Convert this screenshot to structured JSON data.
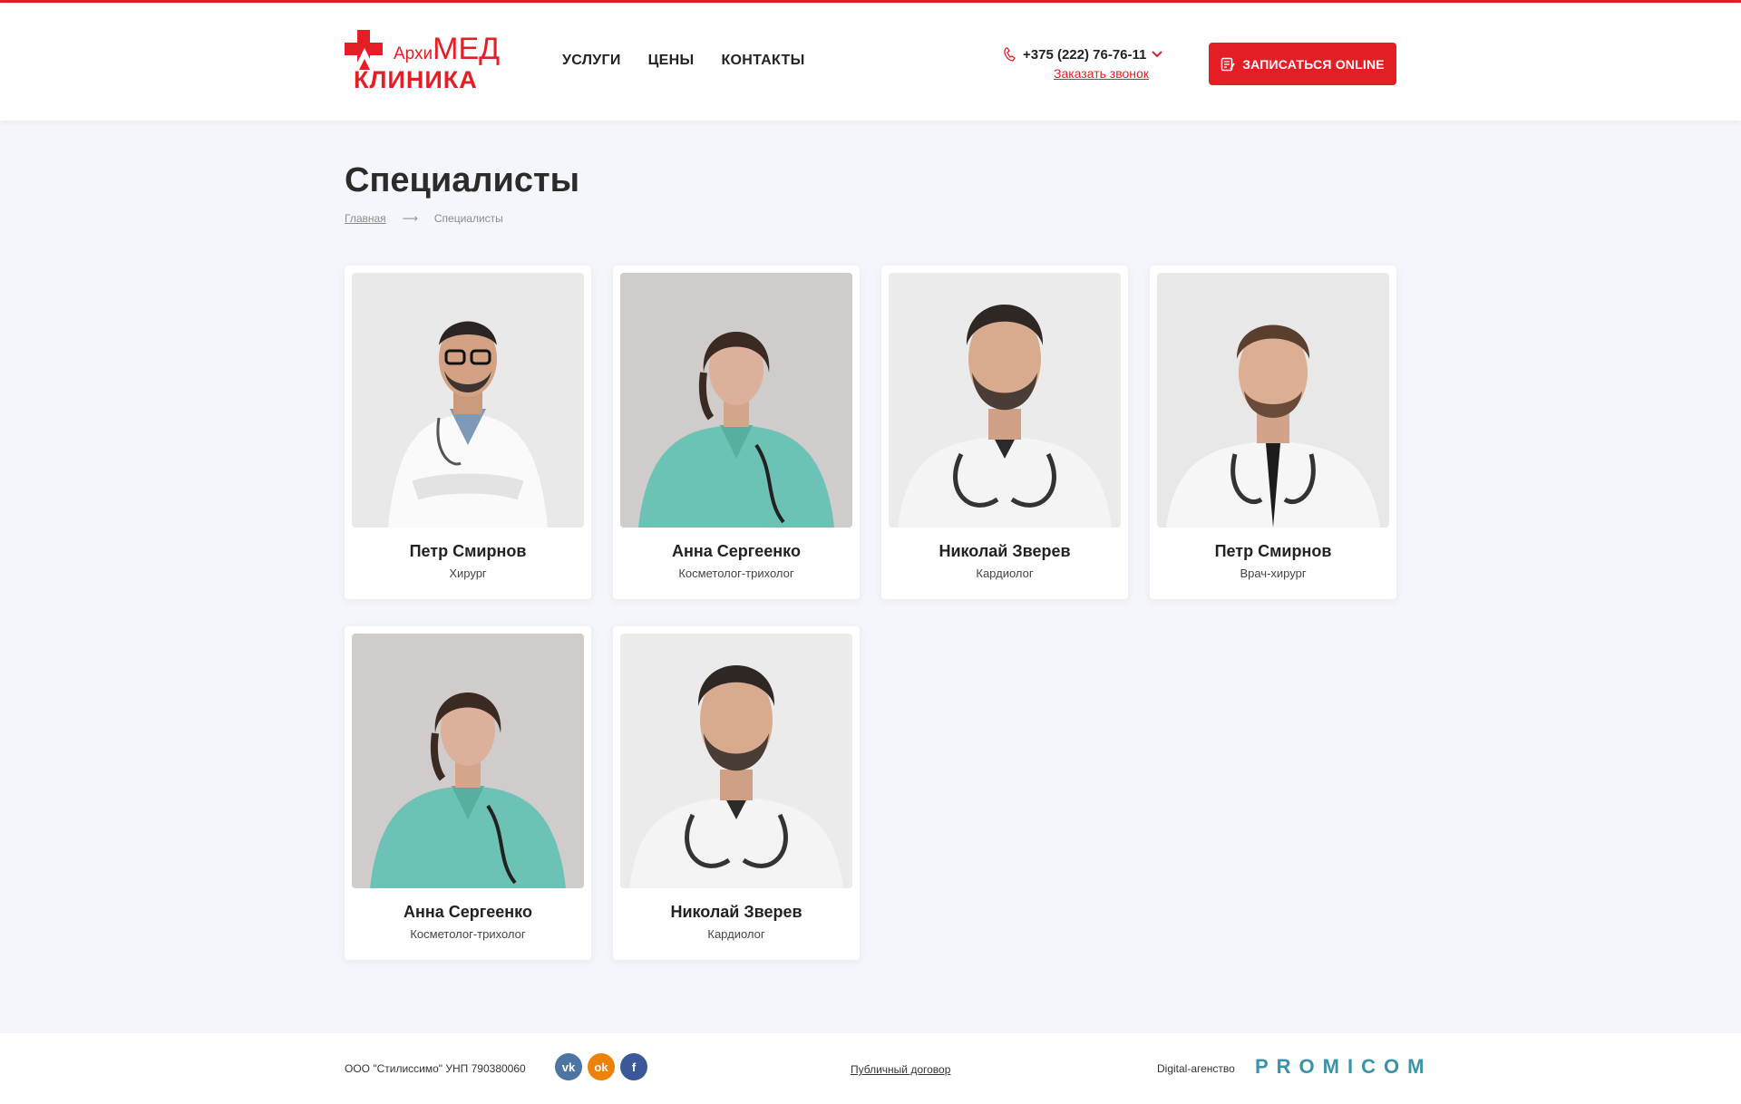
{
  "header": {
    "logo_top": "Архи",
    "logo_top_big": "МЕД",
    "logo_bottom": "КЛИНИКА",
    "nav": [
      "УСЛУГИ",
      "ЦЕНЫ",
      "КОНТАКТЫ"
    ],
    "phone": "+375 (222) 76-76-11",
    "callback": "Заказать звонок",
    "cta": "ЗАПИСАТЬСЯ ONLINE",
    "accent": "#e31e24"
  },
  "page": {
    "title": "Специалисты",
    "breadcrumb": {
      "home": "Главная",
      "separator": "⟶",
      "current": "Специалисты"
    }
  },
  "specialists": [
    {
      "name": "Петр Смирнов",
      "role": "Хирург"
    },
    {
      "name": "Анна Сергеенко",
      "role": "Косметолог-трихолог"
    },
    {
      "name": "Николай Зверев",
      "role": "Кардиолог"
    },
    {
      "name": "Петр Смирнов",
      "role": "Врач-хирург"
    },
    {
      "name": "Анна Сергеенко",
      "role": "Косметолог-трихолог"
    },
    {
      "name": "Николай Зверев",
      "role": "Кардиолог"
    }
  ],
  "footer": {
    "company": "ООО \"Стилиссимо\" УНП 790380060",
    "socials": [
      "vk-icon",
      "odnoklassniki-icon",
      "facebook-icon"
    ],
    "contract": "Публичный договор",
    "agency_label": "Digital-агенство",
    "agency_name": "PROMICOM"
  }
}
